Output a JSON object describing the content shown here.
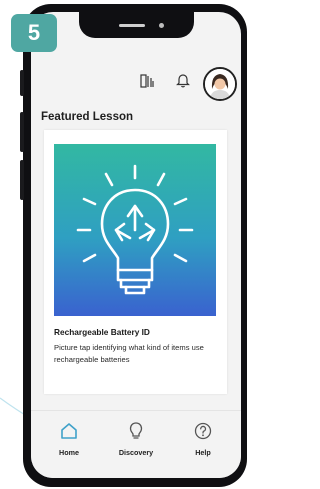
{
  "step_badge": "5",
  "header": {
    "icons": [
      "library-icon",
      "bell-icon",
      "avatar-icon"
    ]
  },
  "section_title": "Featured Lesson",
  "lesson": {
    "title": "Rechargeable Battery ID",
    "description": "Picture tap identifying what kind of items use rechargeable batteries",
    "image_icon": "lightbulb-recycle-icon"
  },
  "nav": {
    "items": [
      {
        "label": "Home",
        "icon": "home-icon"
      },
      {
        "label": "Discovery",
        "icon": "lightbulb-icon"
      },
      {
        "label": "Help",
        "icon": "help-icon"
      }
    ]
  },
  "colors": {
    "badge": "#4fa7a2",
    "accent": "#3fa1c9",
    "gradient_top": "#32b8a2",
    "gradient_bottom": "#3a62cf"
  }
}
